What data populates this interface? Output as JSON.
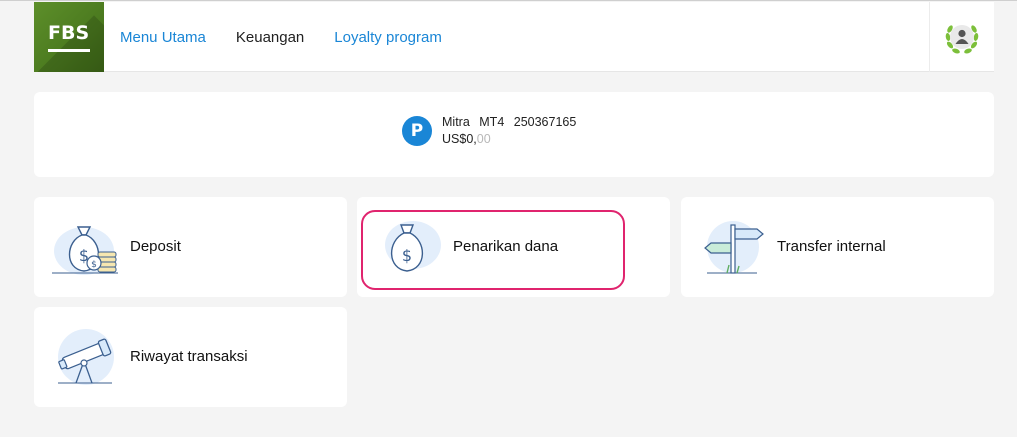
{
  "header": {
    "logo_text": "FBS",
    "nav": [
      {
        "label": "Menu Utama",
        "active": false
      },
      {
        "label": "Keuangan",
        "active": true
      },
      {
        "label": "Loyalty program",
        "active": false
      }
    ],
    "avatar_icon": "user-avatar-laurel-icon"
  },
  "account": {
    "badge": "P",
    "name": "Mitra",
    "platform": "MT4",
    "number": "250367165",
    "balance_main": "US$0,",
    "balance_cents": "00"
  },
  "tiles": [
    {
      "label": "Deposit",
      "icon": "money-bag-coins-icon"
    },
    {
      "label": "Penarikan dana",
      "icon": "money-bag-icon",
      "selected": true
    },
    {
      "label": "Transfer internal",
      "icon": "signpost-icon"
    },
    {
      "label": "Riwayat transaksi",
      "icon": "telescope-icon"
    }
  ],
  "colors": {
    "brand_green": "#4b7a1f",
    "link_blue": "#1a86d6",
    "highlight": "#e0246e",
    "background": "#f4f4f4"
  }
}
